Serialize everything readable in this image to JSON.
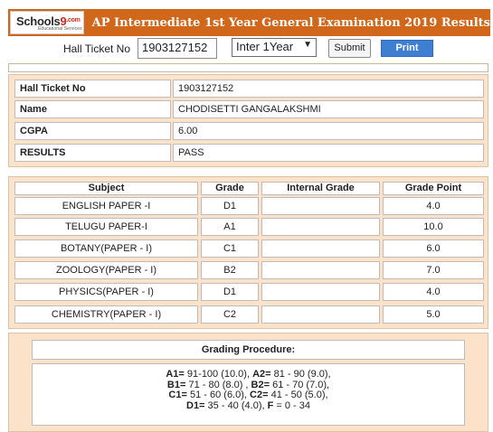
{
  "logo": {
    "brand": "Schools",
    "brand_mark": "9",
    "domain": ".com",
    "tagline": "Educational Services"
  },
  "header": {
    "title": "AP Intermediate 1st Year General Examination 2019 Results"
  },
  "form": {
    "hall_ticket_label": "Hall Ticket No",
    "hall_ticket_value": "1903127152",
    "year_selected": "Inter 1Year",
    "submit_label": "Submit",
    "print_label": "Print"
  },
  "student": [
    {
      "key": "Hall Ticket No",
      "value": "1903127152"
    },
    {
      "key": "Name",
      "value": "CHODISETTI GANGALAKSHMI"
    },
    {
      "key": "CGPA",
      "value": "6.00"
    },
    {
      "key": "RESULTS",
      "value": "PASS"
    }
  ],
  "grades": {
    "headers": [
      "Subject",
      "Grade",
      "Internal Grade",
      "Grade Point"
    ],
    "rows": [
      {
        "subject": "ENGLISH PAPER -I",
        "grade": "D1",
        "internal": "",
        "point": "4.0"
      },
      {
        "subject": "TELUGU PAPER-I",
        "grade": "A1",
        "internal": "",
        "point": "10.0"
      },
      {
        "subject": "BOTANY(PAPER - I)",
        "grade": "C1",
        "internal": "",
        "point": "6.0"
      },
      {
        "subject": "ZOOLOGY(PAPER - I)",
        "grade": "B2",
        "internal": "",
        "point": "7.0"
      },
      {
        "subject": "PHYSICS(PAPER - I)",
        "grade": "D1",
        "internal": "",
        "point": "4.0"
      },
      {
        "subject": "CHEMISTRY(PAPER - I)",
        "grade": "C2",
        "internal": "",
        "point": "5.0"
      }
    ]
  },
  "procedure": {
    "title": "Grading Procedure:",
    "lines": [
      [
        {
          "k": "A1=",
          "v": " 91-100 (10.0), "
        },
        {
          "k": "A2=",
          "v": " 81 - 90 (9.0),"
        }
      ],
      [
        {
          "k": "B1=",
          "v": " 71 - 80 (8.0) , "
        },
        {
          "k": "B2=",
          "v": " 61 - 70 (7.0),"
        }
      ],
      [
        {
          "k": "C1=",
          "v": " 51 - 60 (6.0), "
        },
        {
          "k": "C2=",
          "v": " 41 - 50 (5.0),"
        }
      ],
      [
        {
          "k": "D1=",
          "v": " 35 - 40 (4.0), "
        },
        {
          "k": "F",
          "v": " = 0 - 34"
        }
      ]
    ]
  },
  "colors": {
    "header_bg": "#d0671a",
    "panel_bg": "#fbe2c9",
    "print_button": "#3f7fd1"
  }
}
